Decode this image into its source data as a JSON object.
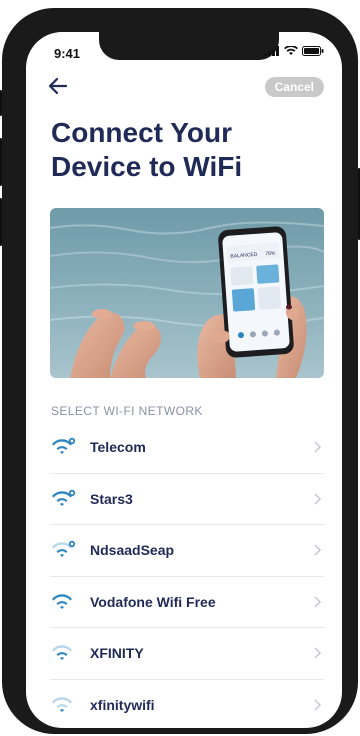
{
  "status_bar": {
    "time": "9:41"
  },
  "header": {
    "back_icon": "arrow-left-icon",
    "cancel_label": "Cancel",
    "title_line1": "Connect Your",
    "title_line2": "Device to WiFi"
  },
  "hero": {
    "phone_screen": {
      "label_small": "BALANCED",
      "value_small": "78%"
    }
  },
  "networks_section": {
    "label": "SELECT WI-FI NETWORK",
    "items": [
      {
        "name": "Telecom",
        "secured": true,
        "signal": "strong"
      },
      {
        "name": "Stars3",
        "secured": true,
        "signal": "strong"
      },
      {
        "name": "NdsaadSeap",
        "secured": true,
        "signal": "medium"
      },
      {
        "name": "Vodafone Wifi Free",
        "secured": false,
        "signal": "strong"
      },
      {
        "name": "XFINITY",
        "secured": false,
        "signal": "medium"
      },
      {
        "name": "xfinitywifi",
        "secured": false,
        "signal": "weak"
      }
    ]
  },
  "colors": {
    "title": "#1f2a57",
    "wifi_blue": "#2e86c1",
    "cancel_bg": "#c9c9c9",
    "label_gray": "#8a91a6"
  }
}
